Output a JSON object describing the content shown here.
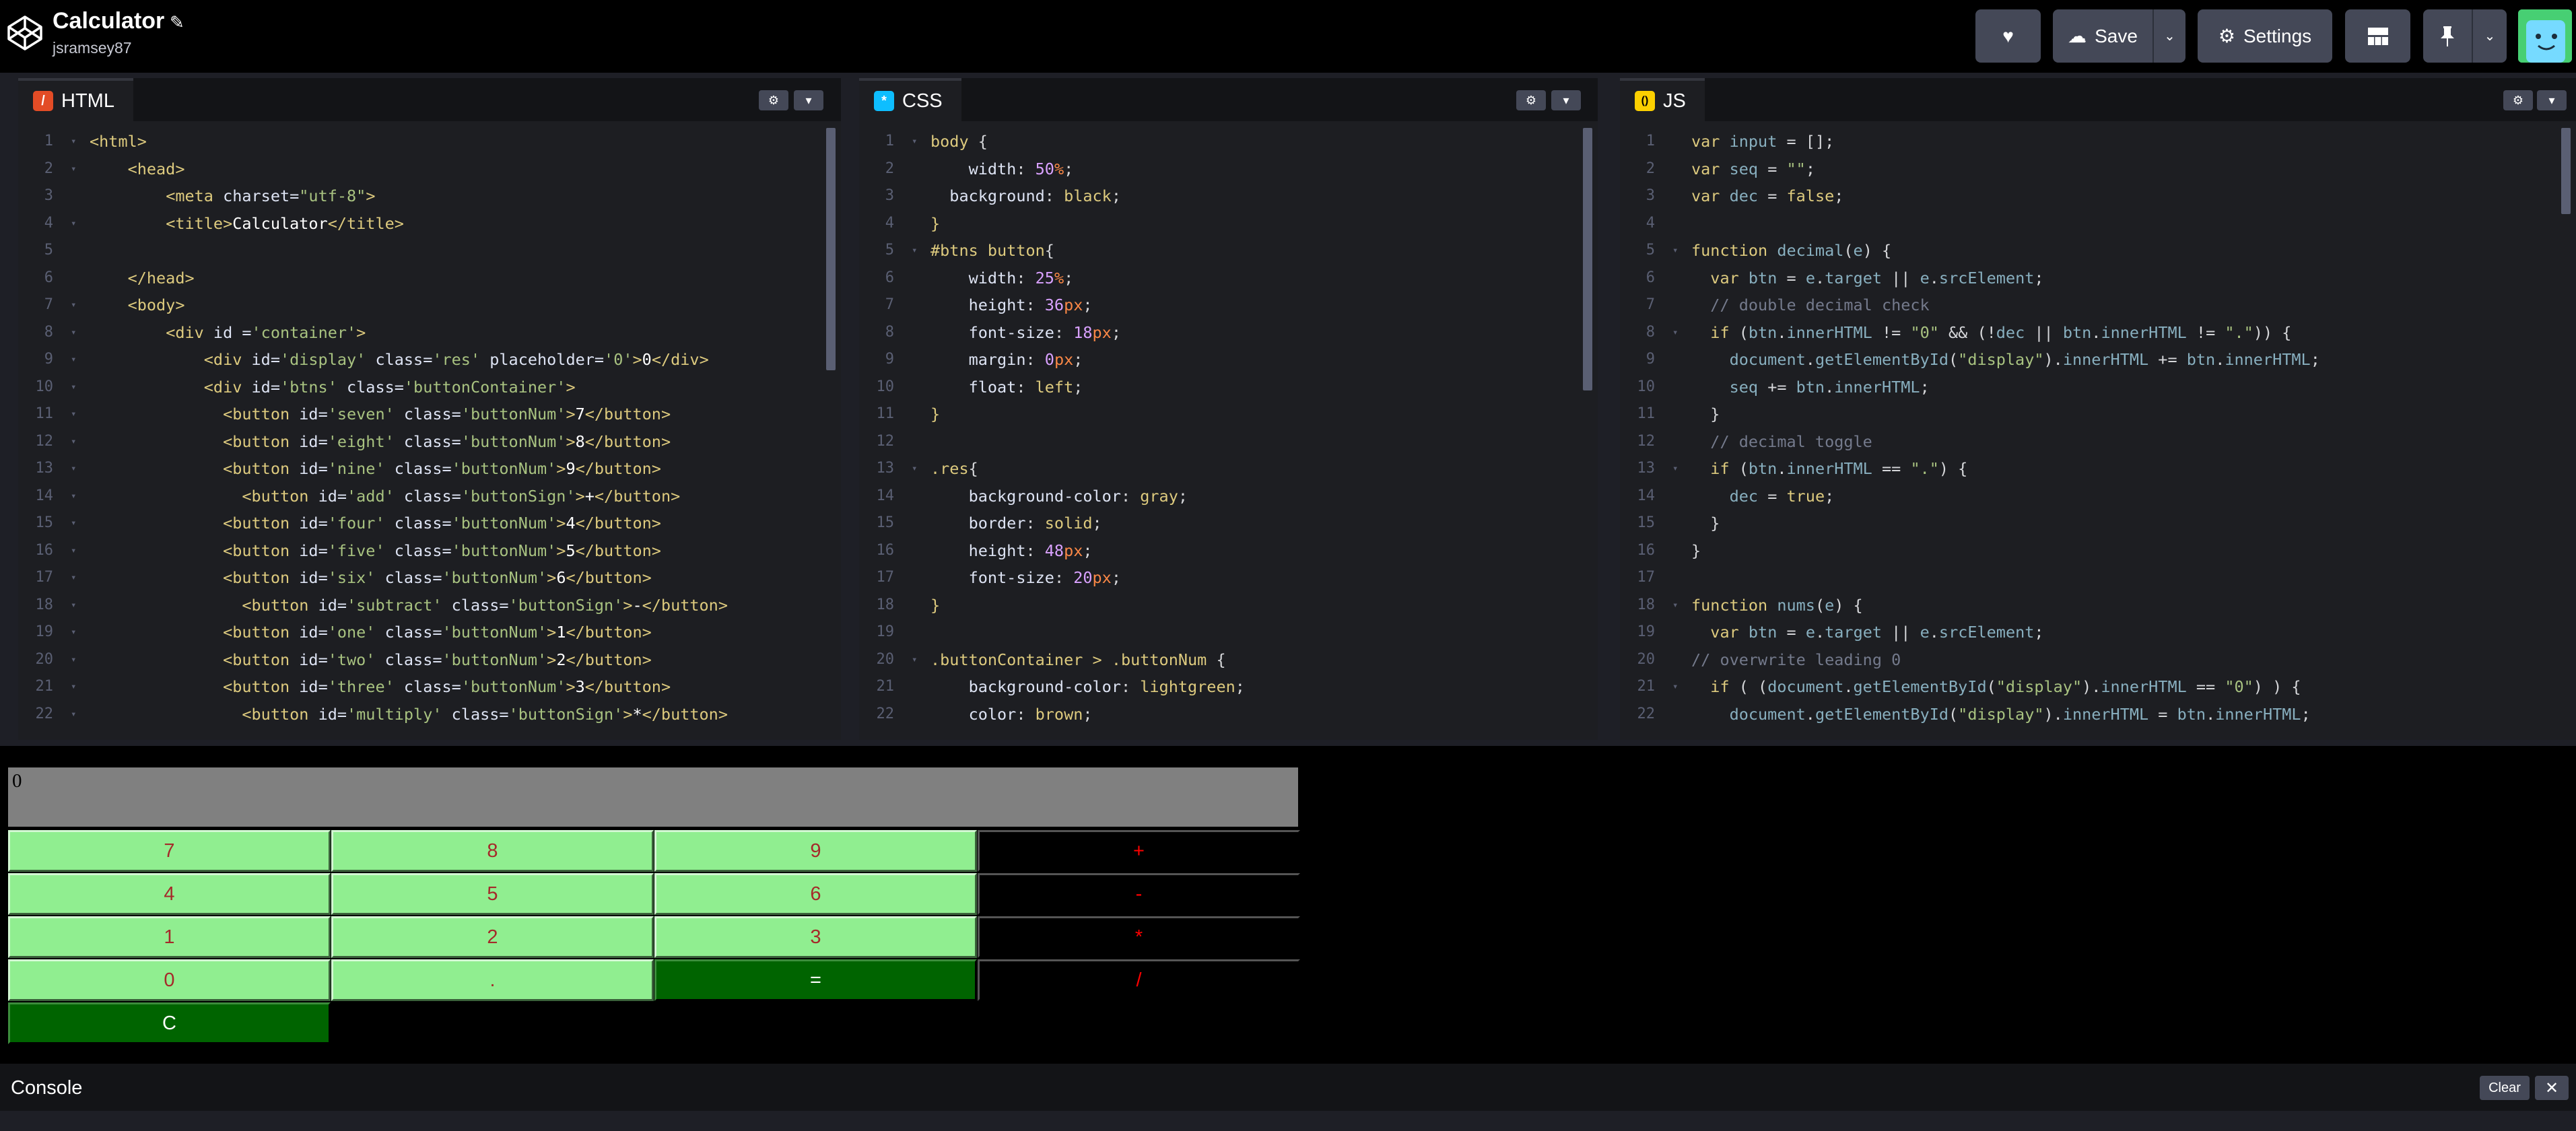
{
  "header": {
    "title": "Calculator",
    "username": "jsramsey87",
    "save_label": "Save",
    "settings_label": "Settings"
  },
  "panes": {
    "html": {
      "label": "HTML",
      "badge": "/",
      "badge_color": "#e34c26"
    },
    "css": {
      "label": "CSS",
      "badge": "*",
      "badge_color": "#0ebeff"
    },
    "js": {
      "label": "JS",
      "badge": "()",
      "badge_color": "#fcd000"
    }
  },
  "code": {
    "html": [
      "<html>",
      "    <head>",
      "        <meta charset=\"utf-8\">",
      "        <title>Calculator</title>",
      "",
      "    </head>",
      "    <body>",
      "        <div id ='container'>",
      "            <div id='display' class='res' placeholder='0'>0</div>",
      "            <div id='btns' class='buttonContainer'>",
      "              <button id='seven' class='buttonNum'>7</button>",
      "              <button id='eight' class='buttonNum'>8</button>",
      "              <button id='nine' class='buttonNum'>9</button>",
      "                <button id='add' class='buttonSign'>+</button>",
      "              <button id='four' class='buttonNum'>4</button>",
      "              <button id='five' class='buttonNum'>5</button>",
      "              <button id='six' class='buttonNum'>6</button>",
      "                <button id='subtract' class='buttonSign'>-</button>",
      "              <button id='one' class='buttonNum'>1</button>",
      "              <button id='two' class='buttonNum'>2</button>",
      "              <button id='three' class='buttonNum'>3</button>",
      "                <button id='multiply' class='buttonSign'>*</button>"
    ],
    "css": [
      "body {",
      "    width: 50%;",
      "  background: black;",
      "}",
      "#btns button{",
      "    width: 25%;",
      "    height: 36px;",
      "    font-size: 18px;",
      "    margin: 0px;",
      "    float: left;",
      "}",
      "",
      ".res{",
      "    background-color: gray;",
      "    border: solid;",
      "    height: 48px;",
      "    font-size: 20px;",
      "}",
      "",
      ".buttonContainer > .buttonNum {",
      "    background-color: lightgreen;",
      "    color: brown;"
    ],
    "js": [
      "var input = [];",
      "var seq = \"\";",
      "var dec = false;",
      "",
      "function decimal(e) {",
      "  var btn = e.target || e.srcElement;",
      "  // double decimal check",
      "  if (btn.innerHTML != \"0\" && (!dec || btn.innerHTML != \".\")) {",
      "    document.getElementById(\"display\").innerHTML += btn.innerHTML;",
      "    seq += btn.innerHTML;",
      "  }",
      "  // decimal toggle",
      "  if (btn.innerHTML == \".\") {",
      "    dec = true;",
      "  }",
      "}",
      "",
      "function nums(e) {",
      "  var btn = e.target || e.srcElement;",
      "// overwrite leading 0",
      "  if ( (document.getElementById(\"display\").innerHTML == \"0\") ) {",
      "    document.getElementById(\"display\").innerHTML = btn.innerHTML;"
    ]
  },
  "preview": {
    "display_value": "0",
    "rows": [
      [
        {
          "label": "7",
          "kind": "num"
        },
        {
          "label": "8",
          "kind": "num"
        },
        {
          "label": "9",
          "kind": "num"
        },
        {
          "label": "+",
          "kind": "sign"
        }
      ],
      [
        {
          "label": "4",
          "kind": "num"
        },
        {
          "label": "5",
          "kind": "num"
        },
        {
          "label": "6",
          "kind": "num"
        },
        {
          "label": "-",
          "kind": "sign"
        }
      ],
      [
        {
          "label": "1",
          "kind": "num"
        },
        {
          "label": "2",
          "kind": "num"
        },
        {
          "label": "3",
          "kind": "num"
        },
        {
          "label": "*",
          "kind": "sign"
        }
      ],
      [
        {
          "label": "0",
          "kind": "num"
        },
        {
          "label": ".",
          "kind": "num"
        },
        {
          "label": "=",
          "kind": "eq"
        },
        {
          "label": "/",
          "kind": "sign"
        }
      ],
      [
        {
          "label": "C",
          "kind": "eq"
        }
      ]
    ]
  },
  "console": {
    "title": "Console",
    "clear_label": "Clear"
  }
}
